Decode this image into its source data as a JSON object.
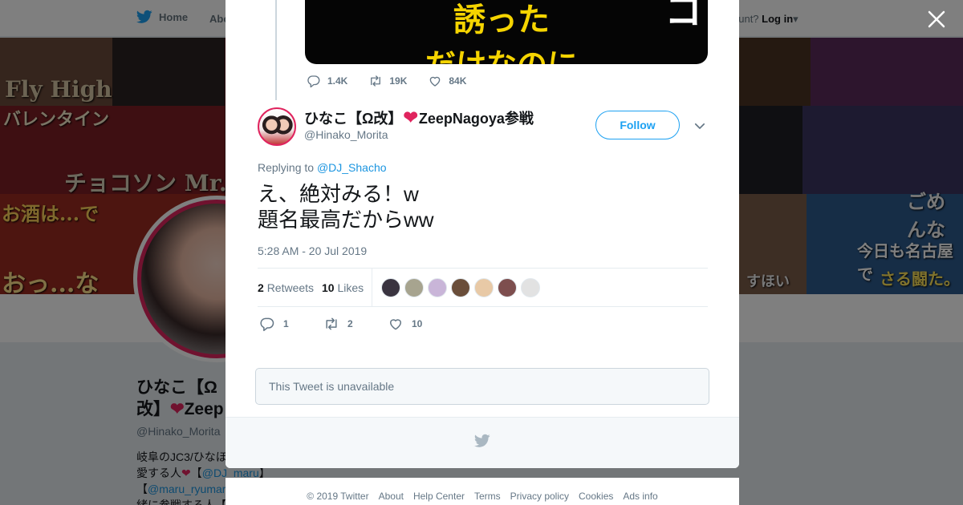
{
  "background": {
    "nav": {
      "home_label": "Home",
      "about_label": "Abo",
      "account_prompt": "ccount?",
      "login_label": "Log in"
    },
    "banner_texts": [
      "Fly High",
      "バレンタイン",
      "チョコソン Mr.C",
      "お酒は...で",
      "おっ...な",
      "ごめんな",
      "今日も名古屋で",
      "さる闘た。",
      "すほい"
    ],
    "profile": {
      "name_line1": "ひなこ【Ω",
      "name_line2": "改】",
      "name_line2_rest": "Zeep",
      "handle": "@Hinako_Morita",
      "bio_line1": "岐阜のJC3/ひなほ",
      "bio_line2_text": "愛する人",
      "bio_line2_link": "@DJ_maru",
      "bio_line3_link": "@maru_ryumar",
      "bio_line4": "緒に参戦する人【"
    }
  },
  "modal": {
    "previous_tweet": {
      "media_text_1": "誘った",
      "media_text_2": "だけなのに",
      "media_text_3": "パコ",
      "reply_count": "1.4K",
      "retweet_count": "19K",
      "like_count": "84K"
    },
    "tweet": {
      "display_name": "ひなこ【Ω改】",
      "display_name_suffix": "ZeepNagoya参戦",
      "handle": "@Hinako_Morita",
      "follow_label": "Follow",
      "replying_to_label": "Replying to",
      "replying_to_handle": "@DJ_Shacho",
      "body": "え、絶対みる！w\n題名最高だからww",
      "timestamp": "5:28 AM - 20 Jul 2019",
      "retweets_count": "2",
      "retweets_label": "Retweets",
      "likes_count": "10",
      "likes_label": "Likes",
      "reply_count": "1",
      "retweet_count": "2",
      "like_count": "10"
    },
    "unavailable_text": "This Tweet is unavailable"
  },
  "footer": {
    "copyright": "© 2019 Twitter",
    "links": [
      "About",
      "Help Center",
      "Terms",
      "Privacy policy",
      "Cookies",
      "Ads info"
    ]
  },
  "colors": {
    "accent": "#1da1f2",
    "heart": "#e0245e",
    "muted": "#657786",
    "link": "#1b95e0"
  },
  "icons": [
    "twitter-bird-icon",
    "close-icon",
    "reply-icon",
    "retweet-icon",
    "like-icon",
    "chevron-down-icon"
  ]
}
